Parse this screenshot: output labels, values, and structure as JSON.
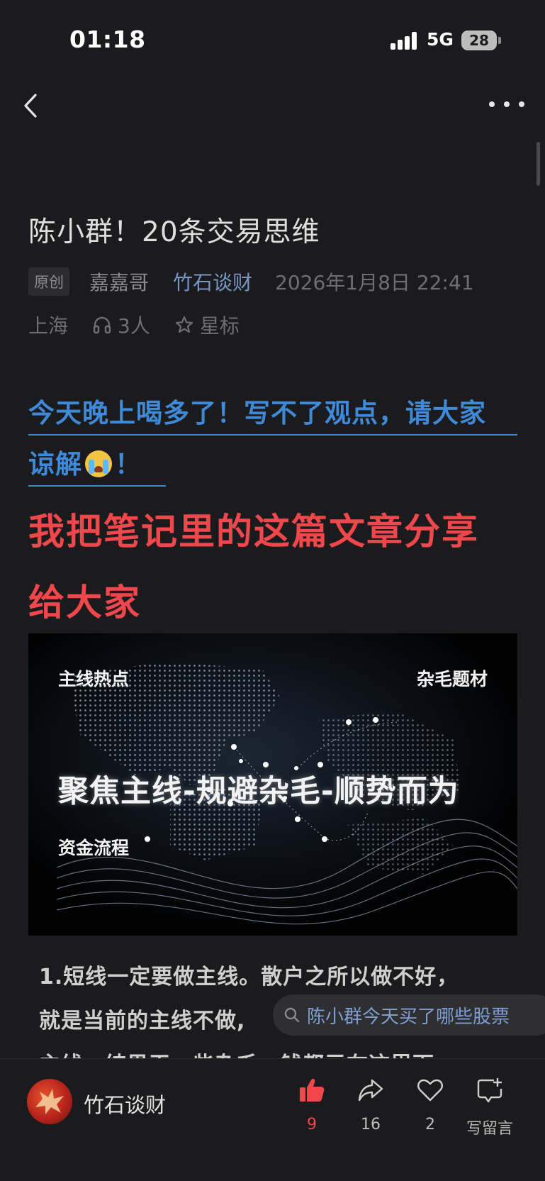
{
  "status_bar": {
    "time": "01:18",
    "network": "5G",
    "battery": "28"
  },
  "article": {
    "title": "陈小群！20条交易思维",
    "badge": "原创",
    "author": "嘉嘉哥",
    "account": "竹石谈财",
    "date": "2026年1月8日 22:41",
    "location": "上海",
    "listeners": "3人",
    "star_label": "星标",
    "headline_blue_1": "今天晚上喝多了！写不了观点，请大家",
    "headline_blue_2a": "谅解",
    "headline_blue_2b": "！",
    "headline_red_1": "我把笔记里的这篇文章分享",
    "headline_red_2": "给大家",
    "image": {
      "label_tl": "主线热点",
      "label_tr": "杂毛题材",
      "main_text": "聚焦主线-规避杂毛-顺势而为",
      "label_bl": "资金流程"
    },
    "paragraph_1": "1.短线一定要做主线。散户之所以做不好，",
    "paragraph_2": "就是当前的主线不做,",
    "paragraph_3": "主线，结果干一些杂毛，钱都亏在这里面。"
  },
  "search_chip": {
    "text": "陈小群今天买了哪些股票",
    "icon": "search-icon"
  },
  "bottom_bar": {
    "account_name": "竹石谈财",
    "like_count": "9",
    "share_count": "16",
    "favorite_count": "2",
    "comment_label": "写留言"
  },
  "colors": {
    "background": "#1b1b1d",
    "accent_blue": "#3f8ad8",
    "accent_red": "#f0474d",
    "link_blue": "#7796c8"
  }
}
